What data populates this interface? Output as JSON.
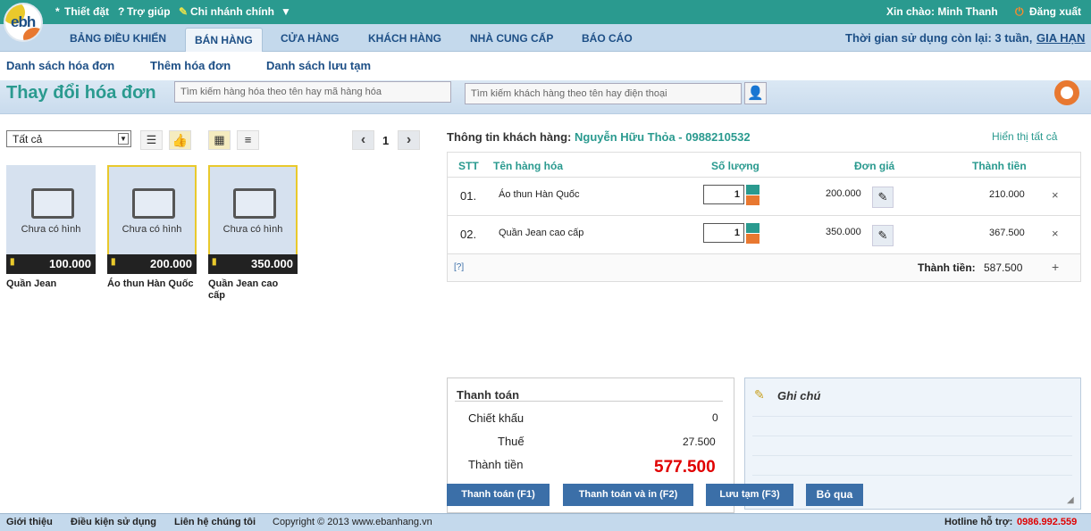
{
  "topbar": {
    "logo": "ebh",
    "settings": "Thiết đặt",
    "help": "Trợ giúp",
    "branch": "Chi nhánh chính",
    "greeting": "Xin chào: Minh Thanh",
    "logout": "Đăng xuất"
  },
  "nav": {
    "tabs": [
      "BẢNG ĐIỀU KHIỂN",
      "BÁN HÀNG",
      "CỬA HÀNG",
      "KHÁCH HÀNG",
      "NHÀ CUNG CẤP",
      "BÁO CÁO"
    ],
    "active": "BÁN HÀNG",
    "time_left": "Thời gian sử dụng còn lại: 3 tuần,",
    "renew": "GIA HẠN"
  },
  "subnav": [
    "Danh sách hóa đơn",
    "Thêm hóa đơn",
    "Danh sách lưu tạm"
  ],
  "title": "Thay đổi hóa đơn",
  "search": {
    "product_placeholder": "Tìm kiếm hàng hóa theo tên hay mã hàng hóa",
    "customer_placeholder": "Tìm kiếm khách hàng theo tên hay điện thoại"
  },
  "filter": {
    "selected": "Tất cả"
  },
  "pager": {
    "page": "1"
  },
  "products": [
    {
      "name": "Quần Jean",
      "price": "100.000",
      "image_text": "Chưa có hình",
      "selected": false
    },
    {
      "name": "Áo thun Hàn Quốc",
      "price": "200.000",
      "image_text": "Chưa có hình",
      "selected": true
    },
    {
      "name": "Quần Jean cao cấp",
      "price": "350.000",
      "image_text": "Chưa có hình",
      "selected": true
    }
  ],
  "customer": {
    "label": "Thông tin khách hàng:",
    "value": "Nguyễn Hữu Thỏa - 0988210532",
    "show_all": "Hiển thị tất cả"
  },
  "table": {
    "headers": [
      "STT",
      "Tên hàng hóa",
      "Số lượng",
      "Đơn giá",
      "Thành tiền"
    ],
    "rows": [
      {
        "stt": "01.",
        "name": "Áo thun Hàn Quốc",
        "qty": "1",
        "price": "200.000",
        "total": "210.000"
      },
      {
        "stt": "02.",
        "name": "Quần Jean cao cấp",
        "qty": "1",
        "price": "350.000",
        "total": "367.500"
      }
    ],
    "help": "[?]",
    "total_label": "Thành tiền:",
    "total_value": "587.500"
  },
  "payment": {
    "title": "Thanh toán",
    "discount_label": "Chiết khấu",
    "discount_value": "0",
    "tax_label": "Thuế",
    "tax_value": "27.500",
    "total_label": "Thành tiền",
    "total_value": "577.500"
  },
  "note": {
    "title": "Ghi chú"
  },
  "buttons": {
    "pay": "Thanh toán (F1)",
    "pay_print": "Thanh toán và in (F2)",
    "save_temp": "Lưu tạm (F3)",
    "skip": "Bỏ qua"
  },
  "footer": {
    "links": [
      "Giới thiệu",
      "Điều kiện sử dụng",
      "Liên hệ chúng tôi"
    ],
    "copyright": "Copyright © 2013 www.ebanhang.vn",
    "hotline_label": "Hotline hỗ trợ:",
    "hotline_number": "0986.992.559"
  },
  "colors": {
    "brand": "#2a9a8f",
    "nav_text": "#1d4f86",
    "total_red": "#e00000",
    "button": "#3b6fa8"
  }
}
